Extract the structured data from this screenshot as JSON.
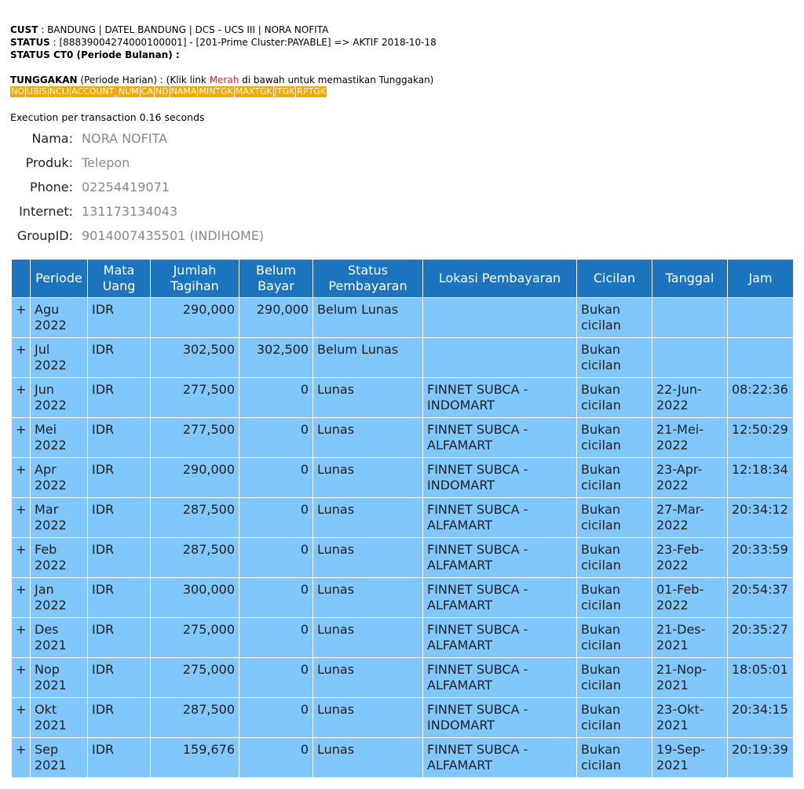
{
  "header": {
    "cust_label": "CUST",
    "cust_value": " : BANDUNG | DATEL BANDUNG | DCS - UCS III | NORA NOFITA",
    "status_label": "STATUS",
    "status_value": " : [88839004274000100001] - [201-Prime Cluster:PAYABLE] => AKTIF 2018-10-18",
    "status_ct0": "STATUS CT0 (Periode Bulanan) :",
    "tunggakan_label": "TUNGGAKAN",
    "tunggakan_text1": " (Periode Harian) : (Klik link ",
    "tunggakan_red": "Merah",
    "tunggakan_text2": " di bawah untuk memastikan Tunggakan)",
    "columns": [
      "NO",
      "UBIS",
      "NCLI",
      "ACCOUNT_NUM",
      "CA",
      "ND",
      "NAMA",
      "MINTGK",
      "MAXTGK",
      "JTGK",
      "RPTGK"
    ]
  },
  "exec_text": "Execution per transaction 0.16 seconds",
  "info": [
    {
      "label": "Nama:",
      "value": "NORA NOFITA"
    },
    {
      "label": "Produk:",
      "value": "Telepon"
    },
    {
      "label": "Phone:",
      "value": "02254419071"
    },
    {
      "label": "Internet:",
      "value": "131173134043"
    },
    {
      "label": "GroupID:",
      "value": "9014007435501 (INDIHOME)"
    }
  ],
  "table": {
    "headers": [
      "",
      "Periode",
      "Mata Uang",
      "Jumlah Tagihan",
      "Belum Bayar",
      "Status Pembayaran",
      "Lokasi Pembayaran",
      "Cicilan",
      "Tanggal",
      "Jam"
    ],
    "rows": [
      {
        "periode": "Agu 2022",
        "uang": "IDR",
        "tagihan": "290,000",
        "belum": "290,000",
        "status": "Belum Lunas",
        "unpaid": true,
        "lokasi": "",
        "cicilan": "Bukan cicilan",
        "tanggal": "",
        "jam": ""
      },
      {
        "periode": "Jul 2022",
        "uang": "IDR",
        "tagihan": "302,500",
        "belum": "302,500",
        "status": "Belum Lunas",
        "unpaid": true,
        "lokasi": "",
        "cicilan": "Bukan cicilan",
        "tanggal": "",
        "jam": ""
      },
      {
        "periode": "Jun 2022",
        "uang": "IDR",
        "tagihan": "277,500",
        "belum": "0",
        "status": "Lunas",
        "unpaid": false,
        "lokasi": "FINNET SUBCA - INDOMART",
        "cicilan": "Bukan cicilan",
        "tanggal": "22-Jun-2022",
        "jam": "08:22:36"
      },
      {
        "periode": "Mei 2022",
        "uang": "IDR",
        "tagihan": "277,500",
        "belum": "0",
        "status": "Lunas",
        "unpaid": false,
        "lokasi": "FINNET SUBCA - ALFAMART",
        "cicilan": "Bukan cicilan",
        "tanggal": "21-Mei-2022",
        "jam": "12:50:29"
      },
      {
        "periode": "Apr 2022",
        "uang": "IDR",
        "tagihan": "290,000",
        "belum": "0",
        "status": "Lunas",
        "unpaid": false,
        "lokasi": "FINNET SUBCA - INDOMART",
        "cicilan": "Bukan cicilan",
        "tanggal": "23-Apr-2022",
        "jam": "12:18:34"
      },
      {
        "periode": "Mar 2022",
        "uang": "IDR",
        "tagihan": "287,500",
        "belum": "0",
        "status": "Lunas",
        "unpaid": false,
        "lokasi": "FINNET SUBCA - ALFAMART",
        "cicilan": "Bukan cicilan",
        "tanggal": "27-Mar-2022",
        "jam": "20:34:12"
      },
      {
        "periode": "Feb 2022",
        "uang": "IDR",
        "tagihan": "287,500",
        "belum": "0",
        "status": "Lunas",
        "unpaid": false,
        "lokasi": "FINNET SUBCA - ALFAMART",
        "cicilan": "Bukan cicilan",
        "tanggal": "23-Feb-2022",
        "jam": "20:33:59"
      },
      {
        "periode": "Jan 2022",
        "uang": "IDR",
        "tagihan": "300,000",
        "belum": "0",
        "status": "Lunas",
        "unpaid": false,
        "lokasi": "FINNET SUBCA - ALFAMART",
        "cicilan": "Bukan cicilan",
        "tanggal": "01-Feb-2022",
        "jam": "20:54:37"
      },
      {
        "periode": "Des 2021",
        "uang": "IDR",
        "tagihan": "275,000",
        "belum": "0",
        "status": "Lunas",
        "unpaid": false,
        "lokasi": "FINNET SUBCA - ALFAMART",
        "cicilan": "Bukan cicilan",
        "tanggal": "21-Des-2021",
        "jam": "20:35:27"
      },
      {
        "periode": "Nop 2021",
        "uang": "IDR",
        "tagihan": "275,000",
        "belum": "0",
        "status": "Lunas",
        "unpaid": false,
        "lokasi": "FINNET SUBCA - ALFAMART",
        "cicilan": "Bukan cicilan",
        "tanggal": "21-Nop-2021",
        "jam": "18:05:01"
      },
      {
        "periode": "Okt 2021",
        "uang": "IDR",
        "tagihan": "287,500",
        "belum": "0",
        "status": "Lunas",
        "unpaid": false,
        "lokasi": "FINNET SUBCA - INDOMART",
        "cicilan": "Bukan cicilan",
        "tanggal": "23-Okt-2021",
        "jam": "20:34:15"
      },
      {
        "periode": "Sep 2021",
        "uang": "IDR",
        "tagihan": "159,676",
        "belum": "0",
        "status": "Lunas",
        "unpaid": false,
        "lokasi": "FINNET SUBCA - ALFAMART",
        "cicilan": "Bukan cicilan",
        "tanggal": "19-Sep-2021",
        "jam": "20:19:39"
      }
    ],
    "expand_symbol": "+"
  }
}
